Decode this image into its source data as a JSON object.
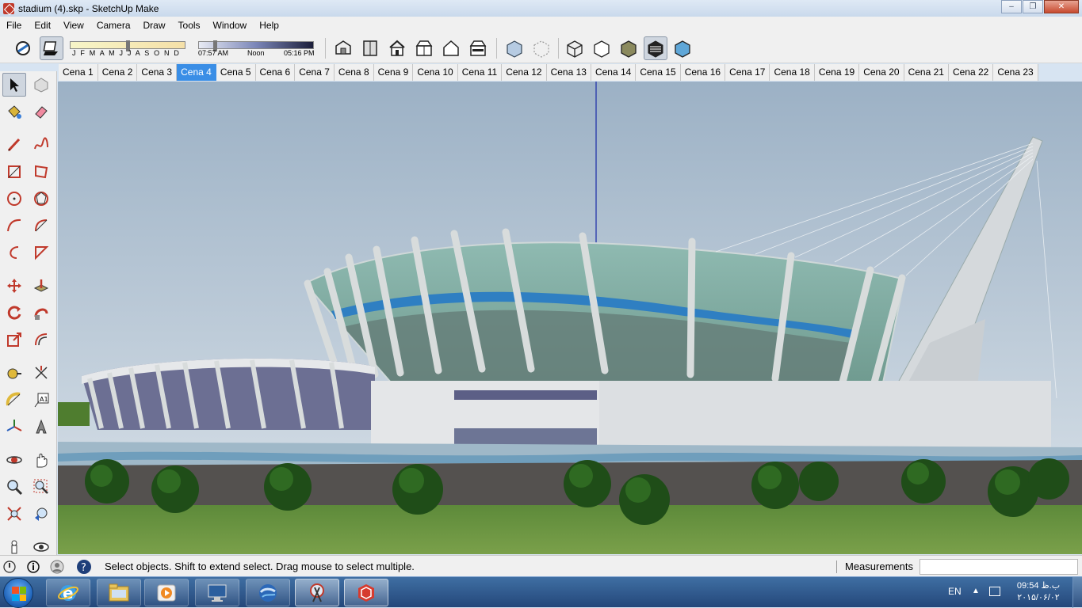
{
  "window": {
    "title": "stadium (4).skp - SketchUp Make",
    "minimize": "‒",
    "maximize": "❐",
    "close": "✕"
  },
  "menu": [
    "File",
    "Edit",
    "View",
    "Camera",
    "Draw",
    "Tools",
    "Window",
    "Help"
  ],
  "shadow_settings": {
    "months": "J F M A M J J A S O N D",
    "time_start": "07:57 AM",
    "time_noon": "Noon",
    "time_end": "05:16 PM"
  },
  "scene_tabs": [
    "Cena 1",
    "Cena 2",
    "Cena 3",
    "Cena 4",
    "Cena 5",
    "Cena 6",
    "Cena 7",
    "Cena 8",
    "Cena 9",
    "Cena 10",
    "Cena 11",
    "Cena 12",
    "Cena 13",
    "Cena 14",
    "Cena 15",
    "Cena 16",
    "Cena 17",
    "Cena 18",
    "Cena 19",
    "Cena 20",
    "Cena 21",
    "Cena 22",
    "Cena 23"
  ],
  "active_scene": "Cena 4",
  "status": {
    "hint": "Select objects. Shift to extend select. Drag mouse to select multiple.",
    "measurements_label": "Measurements",
    "measurements_value": ""
  },
  "taskbar": {
    "language": "EN",
    "time": "09:54 ب.ظ",
    "date": "۲۰۱۵/۰۶/۰۲"
  },
  "colors": {
    "accent_tab": "#3a8ee6",
    "sky": "#a9bccd",
    "grass": "#6f9640",
    "taskbar": "#2d5689"
  }
}
